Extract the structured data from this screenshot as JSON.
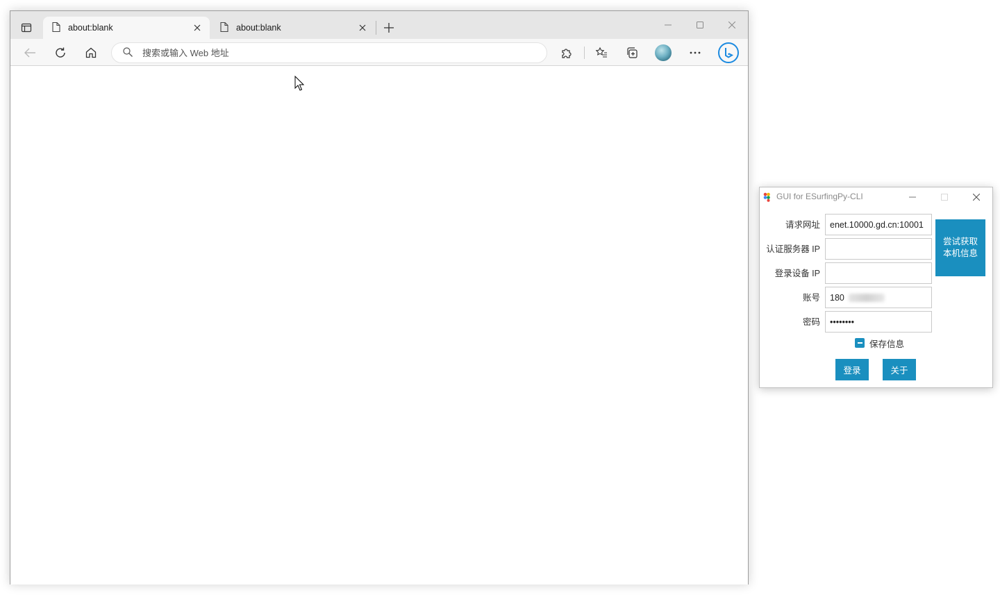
{
  "browser": {
    "tabs": [
      {
        "title": "about:blank",
        "active": true
      },
      {
        "title": "about:blank",
        "active": false
      }
    ],
    "omnibox": {
      "placeholder": "搜索或输入 Web 地址",
      "value": ""
    },
    "icons": [
      "tab-actions-icon",
      "page-icon",
      "close-icon",
      "new-tab-icon",
      "minimize-icon",
      "maximize-icon",
      "back-icon",
      "refresh-icon",
      "home-icon",
      "search-icon",
      "extensions-icon",
      "favorites-icon",
      "collections-icon",
      "profile-avatar",
      "more-icon",
      "bing-chat-icon",
      "mouse-cursor-icon"
    ]
  },
  "app": {
    "title": "GUI for ESurfingPy-CLI",
    "fields": [
      {
        "label": "请求网址",
        "value": "enet.10000.gd.cn:10001"
      },
      {
        "label": "认证服务器 IP",
        "value": ""
      },
      {
        "label": "登录设备 IP",
        "value": ""
      },
      {
        "label": "账号",
        "value": "180"
      },
      {
        "label": "密码",
        "value": "••••••••"
      }
    ],
    "fetch_button": "尝试获取本机信息",
    "save_info": {
      "label": "保存信息",
      "checked": true
    },
    "login_button": "登录",
    "about_button": "关于",
    "accent_color": "#1a8fbf"
  }
}
